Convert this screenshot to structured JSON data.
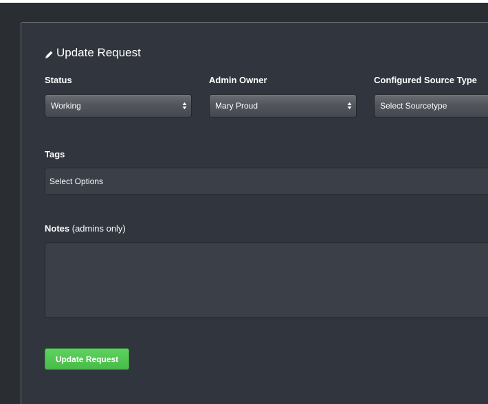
{
  "form": {
    "title": "Update Request",
    "status": {
      "label": "Status",
      "value": "Working"
    },
    "admin_owner": {
      "label": "Admin Owner",
      "value": "Mary Proud"
    },
    "sourcetype": {
      "label": "Configured Source Type",
      "value": "Select Sourcetype"
    },
    "tags": {
      "label": "Tags",
      "placeholder": "Select Options"
    },
    "notes": {
      "label": "Notes",
      "label_suffix": " (admins only)",
      "value": ""
    },
    "submit_label": "Update Request"
  },
  "colors": {
    "background": "#2a2d32",
    "panel": "#31353d",
    "input": "#3b4048",
    "accent_green": "#52c452",
    "text": "#ffffff"
  },
  "icons": {
    "title_icon": "pencil-icon",
    "select_caret": "chevron-up-down-icon"
  }
}
